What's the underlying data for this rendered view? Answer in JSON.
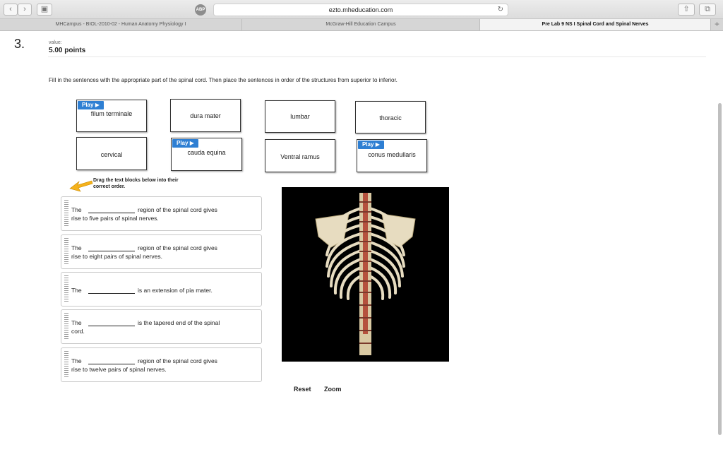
{
  "browser": {
    "url": "ezto.mheducation.com",
    "tabs": [
      "MHCampus - BIOL-2010-02 - Human Anatomy Physiology I",
      "McGraw-Hill Education Campus",
      "Pre Lab 9 NS I Spinal Cord and Spinal Nerves"
    ],
    "abp": "ABP"
  },
  "question": {
    "number": "3.",
    "value_label": "value:",
    "points": "5.00 points",
    "instructions": "Fill in the sentences with the appropriate part of the spinal cord. Then place the sentences in order of the structures from superior to inferior."
  },
  "word_bank": [
    {
      "label": "filum terminale",
      "play": "Play"
    },
    {
      "label": "dura mater",
      "play": ""
    },
    {
      "label": "lumbar",
      "play": ""
    },
    {
      "label": "thoracic",
      "play": ""
    },
    {
      "label": "cervical",
      "play": ""
    },
    {
      "label": "cauda equina",
      "play": "Play"
    },
    {
      "label": "Ventral ramus",
      "play": ""
    },
    {
      "label": "conus medullaris",
      "play": "Play"
    }
  ],
  "drag_hint": [
    "Drag the text blocks below into their",
    "correct order."
  ],
  "sentences": [
    {
      "start": "The",
      "rest": "region of the spinal cord gives",
      "line2": "rise to five pairs of spinal nerves."
    },
    {
      "start": "The",
      "rest": "region of the spinal cord gives",
      "line2": "rise to eight pairs of spinal nerves."
    },
    {
      "start": "The",
      "rest": "is an extension of pia mater.",
      "line2": ""
    },
    {
      "start": "The",
      "rest": "is the tapered end of the spinal",
      "line2": "cord."
    },
    {
      "start": "The",
      "rest": "region of the spinal cord gives",
      "line2": "rise to twelve pairs of spinal nerves."
    }
  ],
  "image_alt": "spine-image",
  "buttons": {
    "reset": "Reset",
    "zoom": "Zoom"
  },
  "colors": {
    "play": "#2e7fd3",
    "arrow": "#f5b21b",
    "spine_bg": "#000000",
    "bone": "#e7dcc0",
    "cord": "#b5523e"
  }
}
